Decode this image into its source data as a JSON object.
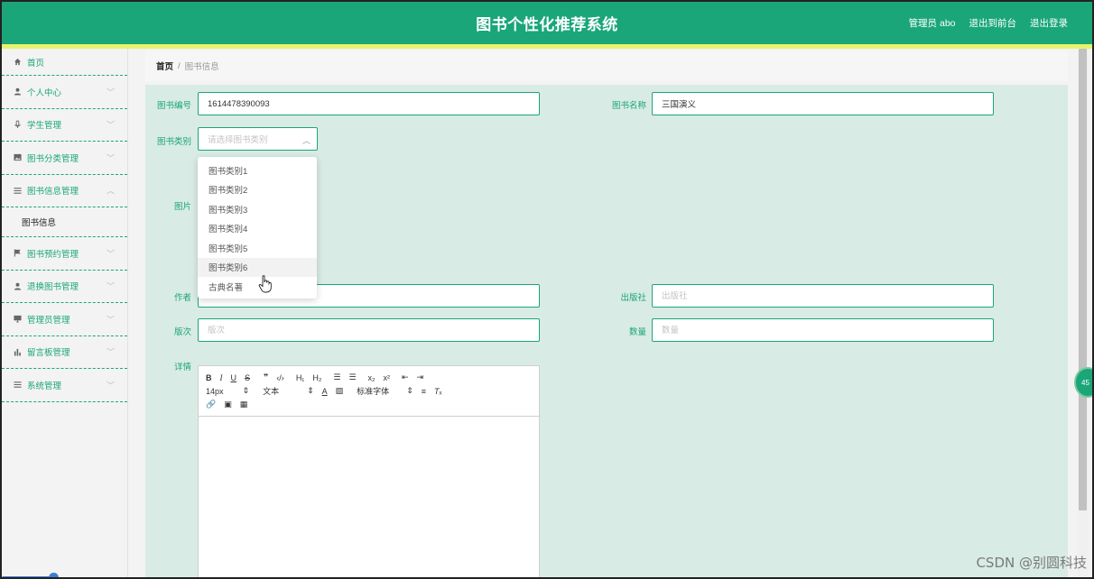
{
  "header": {
    "title": "图书个性化推荐系统",
    "user_label": "管理员 abo",
    "to_front_label": "退出到前台",
    "logout_label": "退出登录",
    "bg_color": "#1aa679",
    "accent_color": "#e7f36b"
  },
  "sidebar": {
    "items": [
      {
        "label": "首页",
        "icon": "home-icon"
      },
      {
        "label": "个人中心",
        "icon": "user-icon"
      },
      {
        "label": "学生管理",
        "icon": "mic-icon"
      },
      {
        "label": "图书分类管理",
        "icon": "image-icon"
      },
      {
        "label": "图书信息管理",
        "icon": "list-icon"
      },
      {
        "label": "图书预约管理",
        "icon": "flag-icon"
      },
      {
        "label": "退换图书管理",
        "icon": "user-alt-icon"
      },
      {
        "label": "管理员管理",
        "icon": "monitor-icon"
      },
      {
        "label": "留言板管理",
        "icon": "bar-chart-icon"
      },
      {
        "label": "系统管理",
        "icon": "list-icon"
      }
    ],
    "submenu_label": "图书信息"
  },
  "breadcrumb": {
    "home": "首页",
    "separator": "/",
    "current": "图书信息"
  },
  "form": {
    "book_no_label": "图书编号",
    "book_no_value": "1614478390093",
    "book_name_label": "图书名称",
    "book_name_value": "三国演义",
    "category_label": "图书类别",
    "category_placeholder": "请选择图书类别",
    "image_label": "图片",
    "author_label": "作者",
    "publisher_label": "出版社",
    "publisher_placeholder": "出版社",
    "edition_label": "版次",
    "edition_placeholder": "版次",
    "quantity_label": "数量",
    "quantity_placeholder": "数量",
    "details_label": "详情"
  },
  "dropdown": {
    "options": [
      "图书类别1",
      "图书类别2",
      "图书类别3",
      "图书类别4",
      "图书类别5",
      "图书类别6",
      "古典名著"
    ],
    "hovered": "图书类别6"
  },
  "editor": {
    "font_size": "14px",
    "text_style": "文本",
    "font_family": "标准字体"
  },
  "float_button_text": "45",
  "watermark": "CSDN @别圆科技"
}
